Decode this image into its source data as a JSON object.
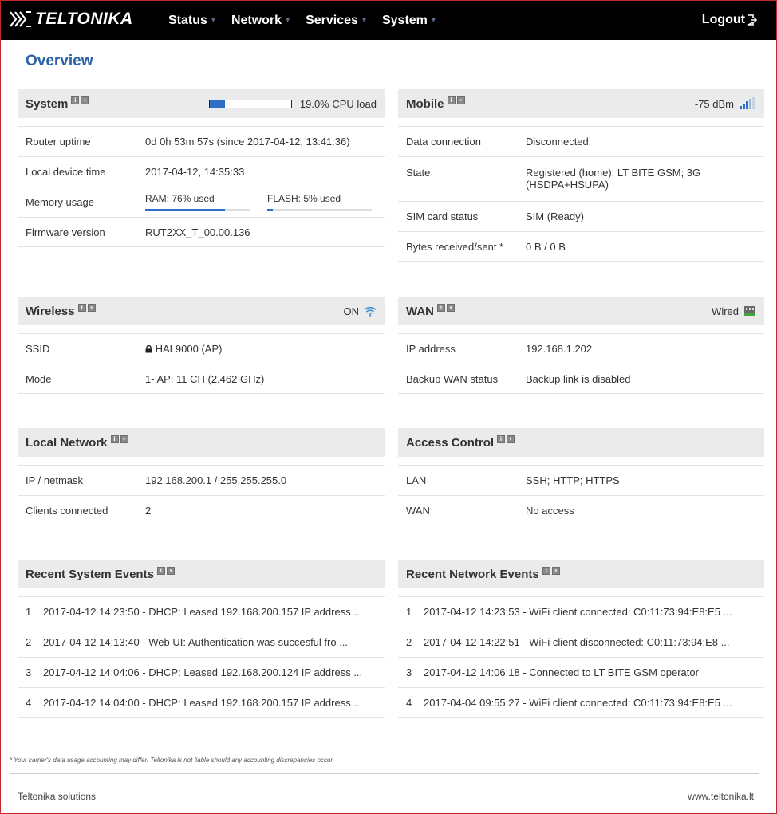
{
  "header": {
    "logo_text": "TELTONIKA",
    "nav": [
      {
        "label": "Status"
      },
      {
        "label": "Network"
      },
      {
        "label": "Services"
      },
      {
        "label": "System"
      }
    ],
    "logout_label": "Logout"
  },
  "page_title": "Overview",
  "system": {
    "title": "System",
    "cpu_load_text": "19.0% CPU load",
    "cpu_load_fraction": 0.19,
    "rows": {
      "uptime_label": "Router uptime",
      "uptime_value": "0d 0h 53m 57s (since 2017-04-12, 13:41:36)",
      "time_label": "Local device time",
      "time_value": "2017-04-12, 14:35:33",
      "memory_label": "Memory usage",
      "ram_text": "RAM: 76% used",
      "ram_fraction": 0.76,
      "flash_text": "FLASH: 5% used",
      "flash_fraction": 0.05,
      "firmware_label": "Firmware version",
      "firmware_value": "RUT2XX_T_00.00.136"
    }
  },
  "mobile": {
    "title": "Mobile",
    "signal_text": "-75 dBm",
    "rows": {
      "data_label": "Data connection",
      "data_value": "Disconnected",
      "state_label": "State",
      "state_value": "Registered (home); LT BITE GSM; 3G (HSDPA+HSUPA)",
      "sim_label": "SIM card status",
      "sim_value": "SIM (Ready)",
      "bytes_label": "Bytes received/sent *",
      "bytes_value": "0 B / 0 B"
    }
  },
  "wireless": {
    "title": "Wireless",
    "status_text": "ON",
    "rows": {
      "ssid_label": "SSID",
      "ssid_value": "HAL9000 (AP)",
      "mode_label": "Mode",
      "mode_value": "1- AP; 11 CH (2.462 GHz)"
    }
  },
  "wan": {
    "title": "WAN",
    "status_text": "Wired",
    "rows": {
      "ip_label": "IP address",
      "ip_value": "192.168.1.202",
      "backup_label": "Backup WAN status",
      "backup_value": "Backup link is disabled"
    }
  },
  "local_network": {
    "title": "Local Network",
    "rows": {
      "ip_label": "IP / netmask",
      "ip_value": "192.168.200.1 / 255.255.255.0",
      "clients_label": "Clients connected",
      "clients_value": "2"
    }
  },
  "access_control": {
    "title": "Access Control",
    "rows": {
      "lan_label": "LAN",
      "lan_value": "SSH; HTTP; HTTPS",
      "wan_label": "WAN",
      "wan_value": "No access"
    }
  },
  "system_events": {
    "title": "Recent System Events",
    "items": [
      {
        "num": "1",
        "text": "2017-04-12 14:23:50 - DHCP: Leased 192.168.200.157 IP address ..."
      },
      {
        "num": "2",
        "text": "2017-04-12 14:13:40 - Web UI: Authentication was succesful fro ..."
      },
      {
        "num": "3",
        "text": "2017-04-12 14:04:06 - DHCP: Leased 192.168.200.124 IP address ..."
      },
      {
        "num": "4",
        "text": "2017-04-12 14:04:00 - DHCP: Leased 192.168.200.157 IP address ..."
      }
    ]
  },
  "network_events": {
    "title": "Recent Network Events",
    "items": [
      {
        "num": "1",
        "text": "2017-04-12 14:23:53 - WiFi client connected: C0:11:73:94:E8:E5 ..."
      },
      {
        "num": "2",
        "text": "2017-04-12 14:22:51 - WiFi client disconnected: C0:11:73:94:E8 ..."
      },
      {
        "num": "3",
        "text": "2017-04-12 14:06:18 - Connected to LT BITE GSM operator"
      },
      {
        "num": "4",
        "text": "2017-04-04 09:55:27 - WiFi client connected: C0:11:73:94:E8:E5 ..."
      }
    ]
  },
  "footer": {
    "note": "* Your carrier's data usage accounting may differ. Teltonika is not liable should any accounting discrepancies occur.",
    "left": "Teltonika solutions",
    "right": "www.teltonika.lt"
  },
  "colors": {
    "topbar": "#000000",
    "accent_blue": "#2a61a6",
    "bar_fill": "#2d6ec9",
    "panel_head": "#ebebeb",
    "frame_red": "#c0282d"
  },
  "icons": {
    "info": "info-icon",
    "settings": "settings-icon",
    "signal": "signal-bars-icon",
    "wifi": "wifi-icon",
    "wired": "ethernet-icon",
    "lock": "lock-icon",
    "logout": "logout-icon"
  }
}
